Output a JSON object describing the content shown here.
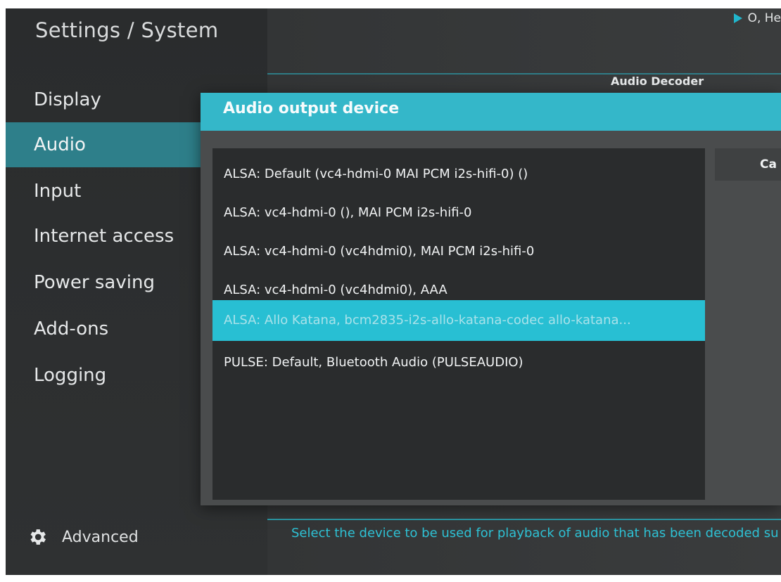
{
  "header": {
    "breadcrumb": "Settings / System",
    "status_text": "O, He"
  },
  "sidebar": {
    "items": [
      {
        "label": "Display"
      },
      {
        "label": "Audio"
      },
      {
        "label": "Input"
      },
      {
        "label": "Internet access"
      },
      {
        "label": "Power saving"
      },
      {
        "label": "Add-ons"
      },
      {
        "label": "Logging"
      }
    ],
    "active_index": 1,
    "advanced_label": "Advanced"
  },
  "main": {
    "section_title": "Audio Decoder",
    "help_text": "Select the device to be used for playback of audio that has been decoded su"
  },
  "dialog": {
    "title": "Audio output device",
    "cancel_label": "Ca",
    "selected_index": 4,
    "devices": [
      {
        "label": "ALSA: Default (vc4-hdmi-0 MAI PCM i2s-hifi-0) ()"
      },
      {
        "label": "ALSA: vc4-hdmi-0 (), MAI PCM i2s-hifi-0"
      },
      {
        "label": "ALSA: vc4-hdmi-0 (vc4hdmi0), MAI PCM i2s-hifi-0"
      },
      {
        "label": "ALSA: vc4-hdmi-0 (vc4hdmi0), AAA"
      },
      {
        "label": "ALSA: Allo Katana, bcm2835-i2s-allo-katana-codec allo-katana..."
      },
      {
        "label": "PULSE: Default, Bluetooth Audio (PULSEAUDIO)"
      }
    ]
  },
  "colors": {
    "accent": "#34b7c9",
    "sidebar_active": "#2e7f8a",
    "background": "#333536",
    "dialog_background": "#4a4c4d",
    "list_background": "#2a2c2d"
  }
}
